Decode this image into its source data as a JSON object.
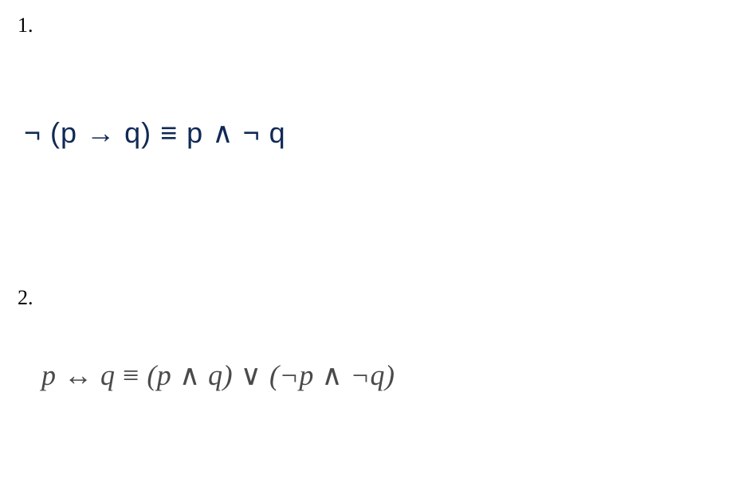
{
  "problems": [
    {
      "number": "1.",
      "expression": "¬ (p → q) ≡ p ∧ ¬ q"
    },
    {
      "number": "2.",
      "expression": "p ↔ q ≡ (p ∧ q) ∨ (¬p ∧ ¬q)"
    }
  ],
  "display": {
    "q1_number": "1.",
    "q1_neg1": "¬",
    "q1_lp": "(p",
    "q1_arrow": "→",
    "q1_rp": "q)",
    "q1_equiv": "≡",
    "q1_p": "p",
    "q1_and": "∧",
    "q1_neg2": "¬",
    "q1_q": "q",
    "q2_number": "2.",
    "q2_p1": "p",
    "q2_biimp": "↔",
    "q2_q1": "q",
    "q2_equiv": "≡",
    "q2_lp1": "(p",
    "q2_and1": "∧",
    "q2_q2": "q)",
    "q2_or": "∨",
    "q2_lp2": "(¬p",
    "q2_and2": "∧",
    "q2_negq": "¬q)"
  }
}
